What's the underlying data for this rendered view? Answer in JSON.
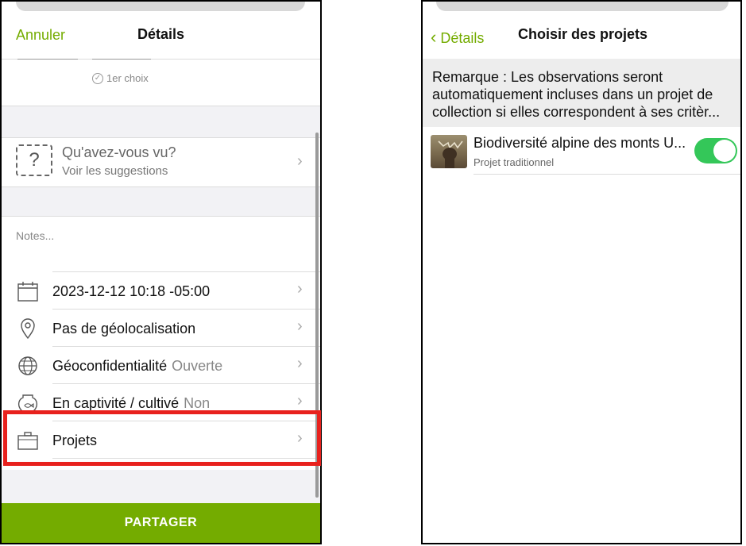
{
  "left": {
    "nav": {
      "cancel": "Annuler",
      "title": "Détails"
    },
    "photo_choice": "1er choix",
    "suggestions": {
      "title": "Qu'avez-vous vu?",
      "subtitle": "Voir les suggestions"
    },
    "notes_placeholder": "Notes...",
    "rows": [
      {
        "label": "2023-12-12 10:18 -05:00",
        "value": "",
        "icon": "calendar-icon"
      },
      {
        "label": "Pas de géolocalisation",
        "value": "",
        "icon": "location-pin-icon"
      },
      {
        "label": "Géoconfidentialité",
        "value": "Ouverte",
        "icon": "globe-icon"
      },
      {
        "label": "En captivité / cultivé",
        "value": "Non",
        "icon": "fishbowl-icon"
      },
      {
        "label": "Projets",
        "value": "",
        "icon": "briefcase-icon"
      }
    ],
    "share": "PARTAGER"
  },
  "right": {
    "nav": {
      "back": "Détails",
      "title": "Choisir des projets"
    },
    "note": "Remarque : Les observations seront automatiquement incluses dans un projet de collection si elles correspondent à ses critèr...",
    "project": {
      "title": "Biodiversité alpine des monts U...",
      "type": "Projet traditionnel",
      "enabled": true
    }
  },
  "colors": {
    "accent": "#74ac00",
    "highlight": "#e8211d",
    "toggle_on": "#34c759"
  }
}
